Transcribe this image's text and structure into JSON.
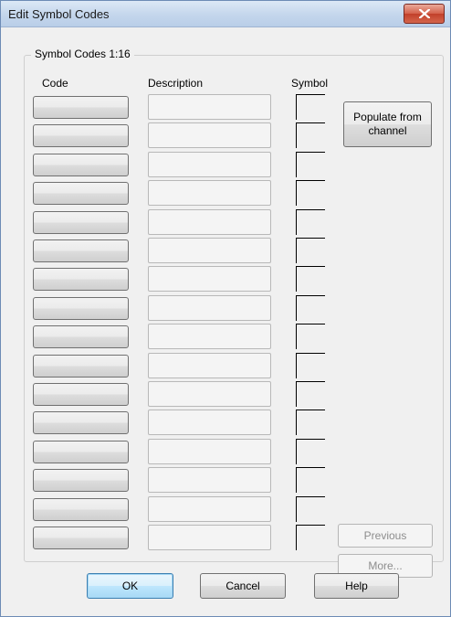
{
  "window": {
    "title": "Edit Symbol Codes"
  },
  "group": {
    "label": "Symbol Codes 1:16"
  },
  "columns": {
    "code": "Code",
    "description": "Description",
    "symbol": "Symbol"
  },
  "rows": [
    {
      "code": "",
      "description": ""
    },
    {
      "code": "",
      "description": ""
    },
    {
      "code": "",
      "description": ""
    },
    {
      "code": "",
      "description": ""
    },
    {
      "code": "",
      "description": ""
    },
    {
      "code": "",
      "description": ""
    },
    {
      "code": "",
      "description": ""
    },
    {
      "code": "",
      "description": ""
    },
    {
      "code": "",
      "description": ""
    },
    {
      "code": "",
      "description": ""
    },
    {
      "code": "",
      "description": ""
    },
    {
      "code": "",
      "description": ""
    },
    {
      "code": "",
      "description": ""
    },
    {
      "code": "",
      "description": ""
    },
    {
      "code": "",
      "description": ""
    },
    {
      "code": "",
      "description": ""
    }
  ],
  "buttons": {
    "populate": "Populate from channel",
    "previous": "Previous",
    "more": "More...",
    "ok": "OK",
    "cancel": "Cancel",
    "help": "Help"
  },
  "icons": {
    "close": "close-icon"
  },
  "colors": {
    "title_bar": "#c4d6ec",
    "close_button": "#c7452f",
    "ok_border": "#3c7fb1"
  }
}
